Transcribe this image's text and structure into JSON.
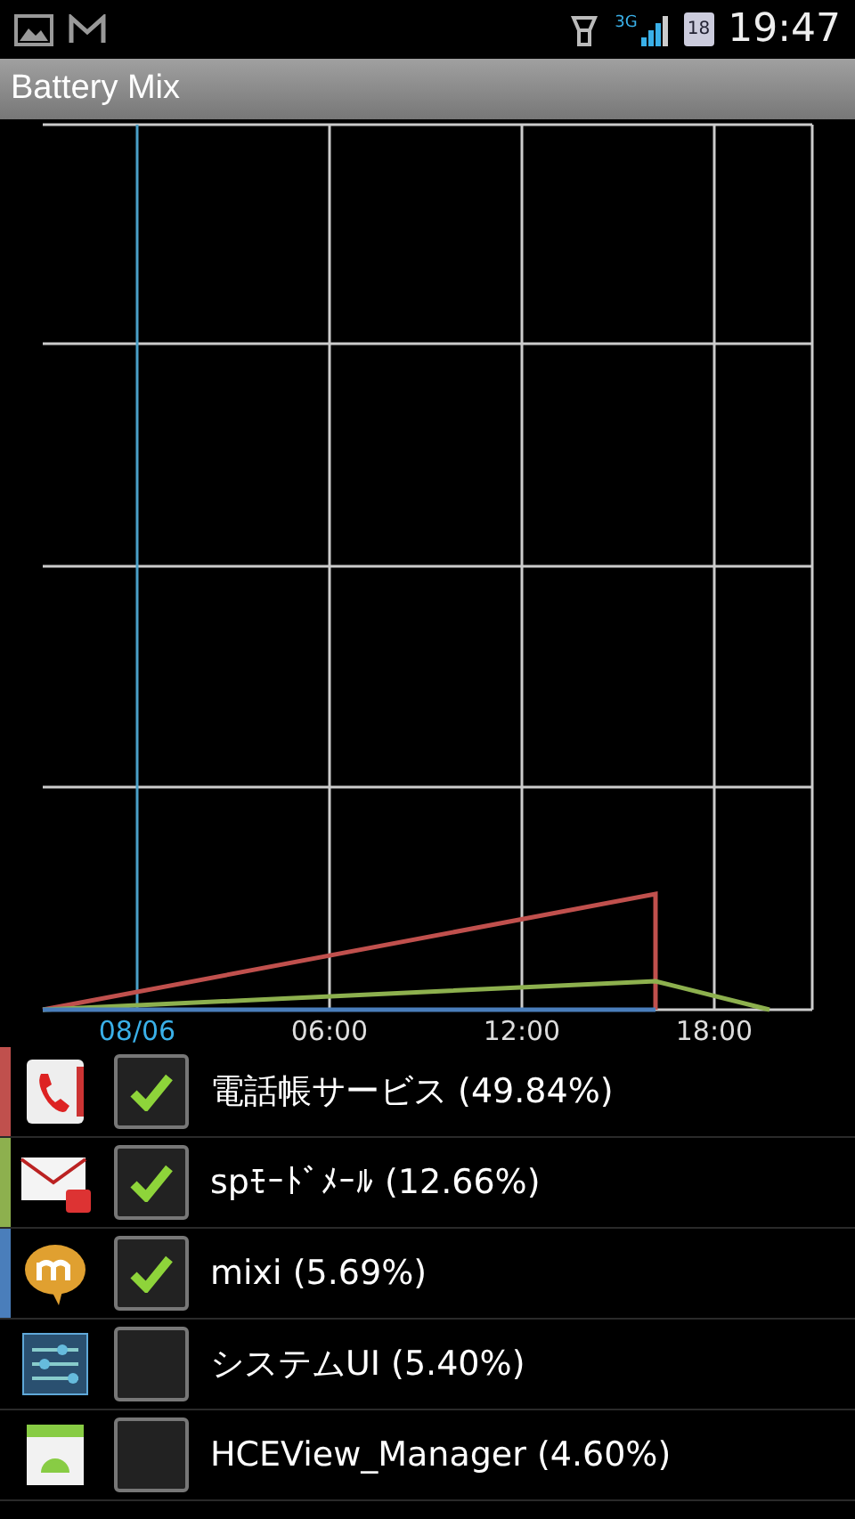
{
  "status_bar": {
    "time": "19:47",
    "network": "3G",
    "battery": "18"
  },
  "app_bar": {
    "title": "Battery Mix"
  },
  "chart": {
    "x_labels": [
      {
        "label": "08/06",
        "highlighted": true
      },
      {
        "label": "06:00",
        "highlighted": false
      },
      {
        "label": "12:00",
        "highlighted": false
      },
      {
        "label": "18:00",
        "highlighted": false
      }
    ]
  },
  "items": [
    {
      "name": "電話帳サービス (49.84%)",
      "checked": true,
      "color": "#c0504d"
    },
    {
      "name": "spﾓｰﾄﾞﾒｰﾙ (12.66%)",
      "checked": true,
      "color": "#8db04e"
    },
    {
      "name": "mixi (5.69%)",
      "checked": true,
      "color": "#4a7ebb"
    },
    {
      "name": "システムUI (5.40%)",
      "checked": false
    },
    {
      "name": "HCEView_Manager (4.60%)",
      "checked": false
    }
  ]
}
